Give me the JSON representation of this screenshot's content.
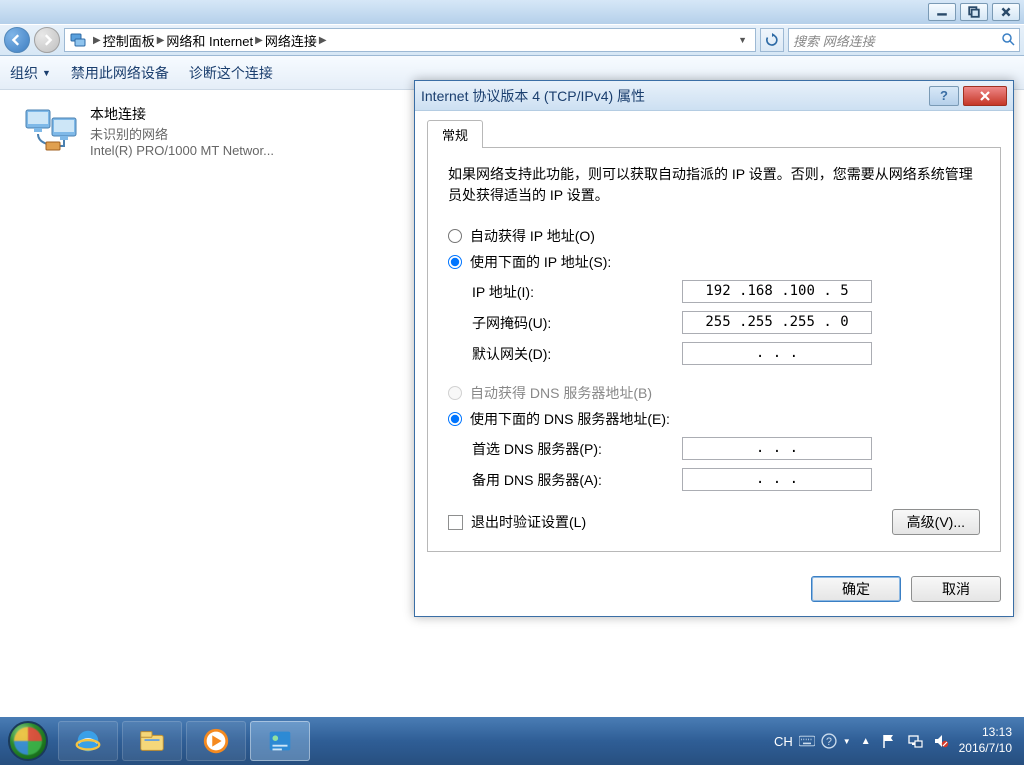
{
  "breadcrumb": {
    "p1": "控制面板",
    "p2": "网络和 Internet",
    "p3": "网络连接"
  },
  "search": {
    "placeholder": "搜索 网络连接"
  },
  "toolbar": {
    "organize": "组织",
    "disable": "禁用此网络设备",
    "diagnose": "诊断这个连接"
  },
  "connection": {
    "title": "本地连接",
    "status": "未识别的网络",
    "adapter": "Intel(R) PRO/1000 MT Networ..."
  },
  "dialog": {
    "title": "Internet 协议版本 4 (TCP/IPv4) 属性",
    "tab": "常规",
    "desc": "如果网络支持此功能，则可以获取自动指派的 IP 设置。否则，您需要从网络系统管理员处获得适当的 IP 设置。",
    "radio_auto_ip": "自动获得 IP 地址(O)",
    "radio_manual_ip": "使用下面的 IP 地址(S):",
    "label_ip": "IP 地址(I):",
    "label_mask": "子网掩码(U):",
    "label_gateway": "默认网关(D):",
    "val_ip": "192 .168 .100 .  5",
    "val_mask": "255 .255 .255 .  0",
    "val_gateway": ".       .       .",
    "radio_auto_dns": "自动获得 DNS 服务器地址(B)",
    "radio_manual_dns": "使用下面的 DNS 服务器地址(E):",
    "label_dns1": "首选 DNS 服务器(P):",
    "label_dns2": "备用 DNS 服务器(A):",
    "val_dns1": ".       .       .",
    "val_dns2": ".       .       .",
    "check_validate": "退出时验证设置(L)",
    "btn_advanced": "高级(V)...",
    "btn_ok": "确定",
    "btn_cancel": "取消",
    "btn_help": "?"
  },
  "tray": {
    "ime": "CH",
    "time": "13:13",
    "date": "2016/7/10"
  }
}
